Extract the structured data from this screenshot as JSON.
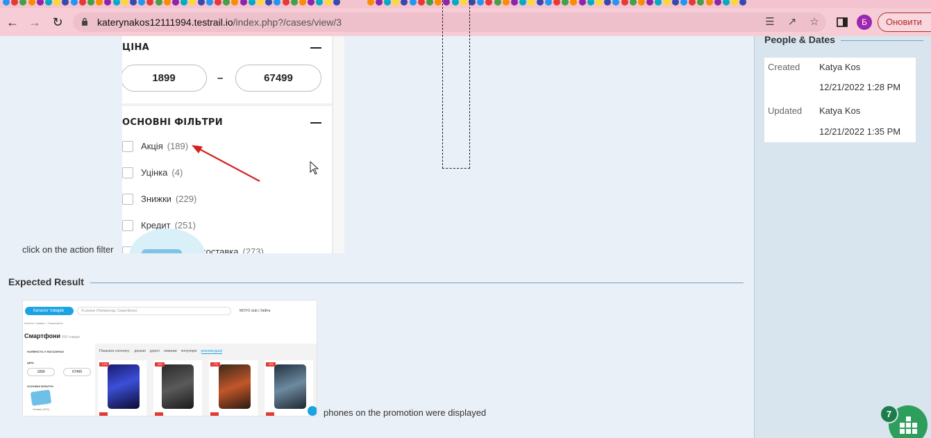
{
  "browser": {
    "url_host": "katerynakos12111994.testrail.io",
    "url_path": "/index.php?/cases/view/3",
    "avatar_letter": "Б",
    "update_label": "Оновити"
  },
  "step": {
    "screenshot": {
      "price_section_title": "ЦІНА",
      "price_min": "1899",
      "price_max": "67499",
      "price_dash": "–",
      "filters_section_title": "ОСНОВНІ ФІЛЬТРИ",
      "filters": [
        {
          "label": "Акція",
          "count": "(189)"
        },
        {
          "label": "Уцінка",
          "count": "(4)"
        },
        {
          "label": "Знижки",
          "count": "(229)"
        },
        {
          "label": "Кредит",
          "count": "(251)"
        },
        {
          "label": "на доставка",
          "count": "(273)"
        }
      ]
    },
    "text": "click on the action filter"
  },
  "expected": {
    "heading": "Expected Result",
    "screenshot": {
      "catalog_button": "Каталог товарів",
      "search_placeholder": "Я шукаю (Наприклад, Смартфони)",
      "header_links": "MOYO club   |   Увійти",
      "breadcrumb": "Каталог товарів  >  Смартфони",
      "page_title": "Смартфони",
      "page_count": "663 товари",
      "left_title": "НАЯВНІСТЬ У МАГАЗИНАХ",
      "price_title": "ЦІНА",
      "price_min": "1899",
      "price_max": "67499",
      "filters_title": "ОСНОВНІ ФІЛЬТРИ",
      "filter_bottom": "Знижки  (229)",
      "sort_tabs": [
        "Показати спочатку:",
        "дешеві",
        "дорогі",
        "новинки",
        "популярні",
        "рекомендації"
      ],
      "discount_badges": [
        "-14%",
        "-6%",
        "-7%",
        "-8%"
      ]
    },
    "text": "phones on the promotion were displayed"
  },
  "sidebar": {
    "heading": "People & Dates",
    "created_label": "Created",
    "created_by": "Katya Kos",
    "created_at": "12/21/2022 1:28 PM",
    "updated_label": "Updated",
    "updated_by": "Katya Kos",
    "updated_at": "12/21/2022 1:35 PM"
  },
  "help": {
    "badge_count": "7"
  }
}
